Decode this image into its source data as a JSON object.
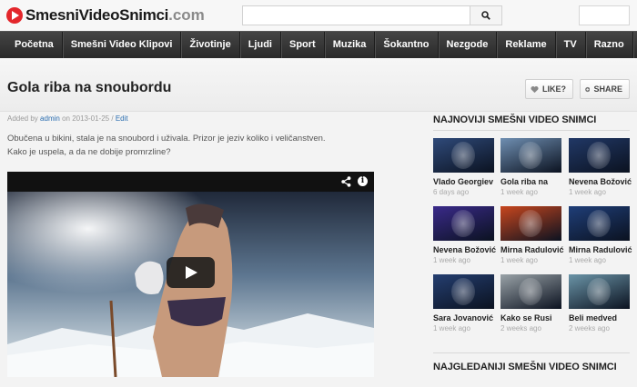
{
  "site": {
    "logo_text": "SmesniVideoSnimci",
    "logo_domain": ".com",
    "search_placeholder": ""
  },
  "nav": [
    {
      "label": "Početna"
    },
    {
      "label": "Smešni Video Klipovi"
    },
    {
      "label": "Životinje"
    },
    {
      "label": "Ljudi"
    },
    {
      "label": "Sport"
    },
    {
      "label": "Muzika"
    },
    {
      "label": "Šokantno"
    },
    {
      "label": "Nezgode"
    },
    {
      "label": "Reklame"
    },
    {
      "label": "TV"
    },
    {
      "label": "Razno"
    }
  ],
  "article": {
    "title": "Gola riba na snoubordu",
    "like_label": "LIKE?",
    "share_label": "SHARE",
    "meta_prefix": "Added by",
    "author": "admin",
    "date": "on 2013-01-25",
    "sep": "/",
    "edit_label": "Edit",
    "description_1": "Obučena u bikini, stala je na snoubord i uživala. Prizor je jeziv koliko i veličanstven.",
    "description_2": "Kako je uspela, a da ne dobije promrzline?"
  },
  "sidebar": {
    "latest_title": "NAJNOVIJI SMEŠNI VIDEO SNIMCI",
    "latest": [
      {
        "name": "Vlado Georgiev",
        "time": "6 days ago",
        "color": "#2f4a7a"
      },
      {
        "name": "Gola riba na",
        "time": "1 week ago",
        "color": "#6f8fb2"
      },
      {
        "name": "Nevena Božović",
        "time": "1 week ago",
        "color": "#213866"
      },
      {
        "name": "Nevena Božović",
        "time": "1 week ago",
        "color": "#3a2a8a"
      },
      {
        "name": "Mirna Radulović",
        "time": "1 week ago",
        "color": "#c8461e"
      },
      {
        "name": "Mirna Radulović",
        "time": "1 week ago",
        "color": "#1f3e78"
      },
      {
        "name": "Sara Jovanović",
        "time": "1 week ago",
        "color": "#243e70"
      },
      {
        "name": "Kako se Rusi",
        "time": "2 weeks ago",
        "color": "#9aa3a8"
      },
      {
        "name": "Beli medved",
        "time": "2 weeks ago",
        "color": "#6b95a8"
      }
    ],
    "popular_title": "NAJGLEDANIJI SMEŠNI VIDEO SNIMCI"
  }
}
